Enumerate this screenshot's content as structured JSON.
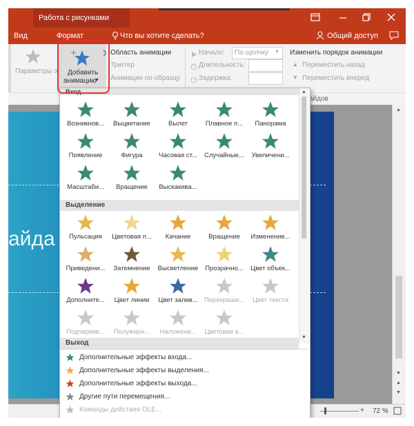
{
  "titlebar": {
    "context_label": "Работа с рисунками",
    "buttons": [
      "restore-ribbon-icon",
      "minimize-icon",
      "maximize-icon",
      "close-icon"
    ]
  },
  "tabs": {
    "vid": "Вид",
    "format": "Формат",
    "tell_me": "Что вы хотите сделать?",
    "share": "Общий доступ"
  },
  "ribbon": {
    "effect_params": "Параметры эффектов",
    "add_animation_line1": "Добавить",
    "add_animation_line2": "анимацию",
    "animation_pane": "Область анимации",
    "trigger": "Триггер",
    "animation_painter": "Анимация по образцу",
    "start_label": "Начало:",
    "start_value": "По щелчку",
    "duration_label": "Длительность:",
    "delay_label": "Задержка:",
    "reorder_title": "Изменить порядок анимации",
    "move_back": "Переместить назад",
    "move_forward": "Переместить вперед",
    "group_tail": "айдов"
  },
  "slide": {
    "title_fragment": "айда"
  },
  "dropdown": {
    "sections": [
      {
        "title": "Вход",
        "color": "#3a8a6e",
        "items": [
          {
            "label": "Возникнов...",
            "icon": "appear-burst-icon"
          },
          {
            "label": "Выцветание",
            "icon": "fade-star-icon"
          },
          {
            "label": "Вылет",
            "icon": "fly-in-star-icon"
          },
          {
            "label": "Плавное п...",
            "icon": "float-in-star-icon"
          },
          {
            "label": "Панорама",
            "icon": "split-star-icon"
          },
          {
            "label": "Появление",
            "icon": "wipe-star-icon"
          },
          {
            "label": "Фигура",
            "icon": "shape-star-icon"
          },
          {
            "label": "Часовая ст...",
            "icon": "wheel-star-icon"
          },
          {
            "label": "Случайные...",
            "icon": "random-bars-star-icon"
          },
          {
            "label": "Увеличени...",
            "icon": "grow-turn-star-icon"
          },
          {
            "label": "Масштаби...",
            "icon": "zoom-star-icon"
          },
          {
            "label": "Вращение",
            "icon": "swivel-star-icon"
          },
          {
            "label": "Выскакива...",
            "icon": "bounce-star-icon"
          }
        ]
      },
      {
        "title": "Выделение",
        "color": "#e5b04a",
        "items": [
          {
            "label": "Пульсация",
            "icon": "pulse-star-icon",
            "color": "#e7b54e"
          },
          {
            "label": "Цветовая п...",
            "icon": "color-pulse-star-icon",
            "color": "#f0d690"
          },
          {
            "label": "Качание",
            "icon": "teeter-star-icon",
            "color": "#e5a83c"
          },
          {
            "label": "Вращение",
            "icon": "spin-star-icon",
            "color": "#e5a83c"
          },
          {
            "label": "Изменение...",
            "icon": "grow-shrink-star-icon",
            "color": "#e5a83c"
          },
          {
            "label": "Приведени...",
            "icon": "desaturate-star-icon",
            "color": "#d7b06a"
          },
          {
            "label": "Затемнение",
            "icon": "darken-star-icon",
            "color": "#6b5a3a"
          },
          {
            "label": "Высветление",
            "icon": "lighten-star-icon",
            "color": "#e8b850"
          },
          {
            "label": "Прозрачно...",
            "icon": "transparency-star-icon",
            "color": "#f1cf7a"
          },
          {
            "label": "Цвет объек...",
            "icon": "object-color-star-icon",
            "color": "#3d8a8a"
          },
          {
            "label": "Дополните...",
            "icon": "complementary-star-icon",
            "color": "#6a3a8a"
          },
          {
            "label": "Цвет линии",
            "icon": "line-color-star-icon",
            "color": "#e5a83c"
          },
          {
            "label": "Цвет залив...",
            "icon": "fill-color-star-icon",
            "color": "#3a6aa0"
          },
          {
            "label": "Перекраши...",
            "icon": "brush-color-star-icon",
            "color": "#c8c8c8",
            "disabled": true
          },
          {
            "label": "Цвет текста",
            "icon": "font-color-star-icon",
            "color": "#c8c8c8",
            "disabled": true
          },
          {
            "label": "Подчеркив...",
            "icon": "underline-star-icon",
            "color": "#c8c8c8",
            "disabled": true
          },
          {
            "label": "Полужирн...",
            "icon": "bold-flash-star-icon",
            "color": "#c8c8c8",
            "disabled": true
          },
          {
            "label": "Наложени...",
            "icon": "bold-reveal-star-icon",
            "color": "#c8c8c8",
            "disabled": true
          },
          {
            "label": "Цветовая в...",
            "icon": "wave-star-icon",
            "color": "#c8c8c8",
            "disabled": true
          }
        ]
      },
      {
        "title": "Выход"
      }
    ],
    "menu": [
      {
        "label": "Дополнительные эффекты входа...",
        "icon": "entrance-star-icon",
        "color": "#3a8a6e"
      },
      {
        "label": "Дополнительные эффекты выделения...",
        "icon": "emphasis-star-icon",
        "color": "#e5b04a"
      },
      {
        "label": "Дополнительные эффекты выхода...",
        "icon": "exit-star-icon",
        "color": "#c8452a"
      },
      {
        "label": "Другие пути перемещения...",
        "icon": "motion-path-star-icon",
        "color": "#888888"
      },
      {
        "label": "Команды действия OLE...",
        "icon": "ole-action-icon",
        "color": "#bbbbbb",
        "disabled": true
      }
    ]
  },
  "status": {
    "zoom": "72 %"
  }
}
